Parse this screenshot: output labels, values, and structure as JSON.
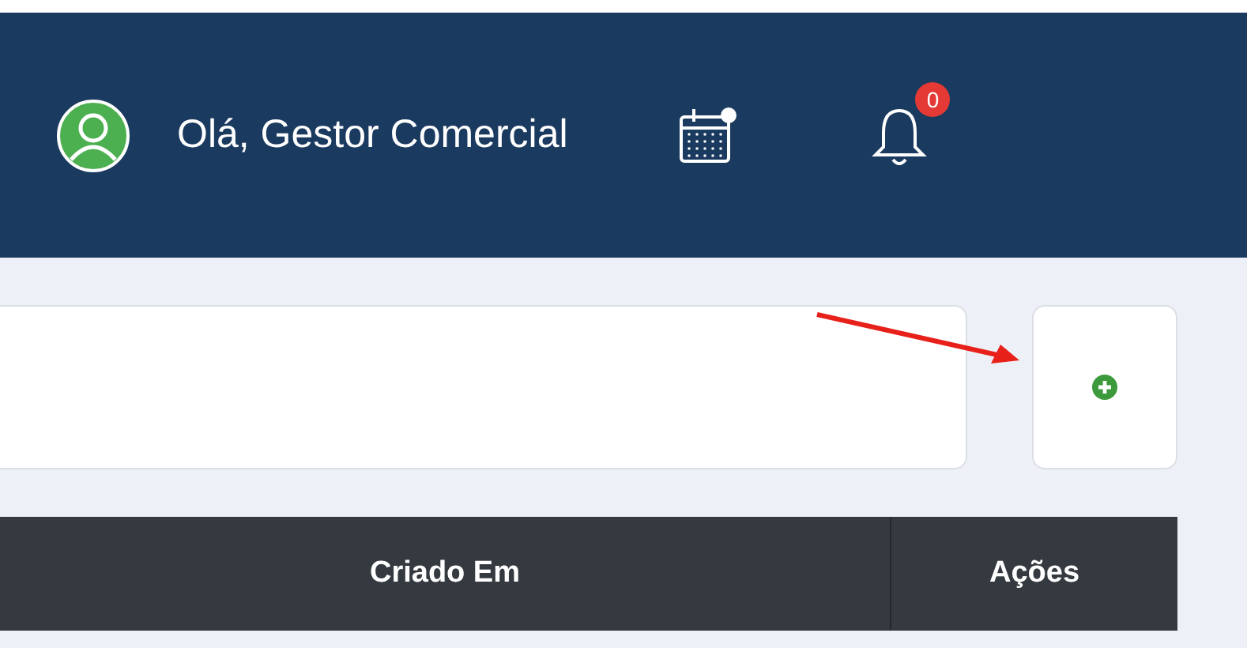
{
  "header": {
    "greeting": "Olá, Gestor Comercial",
    "notification_count": "0"
  },
  "table": {
    "columns": [
      {
        "label": "Criado Em"
      },
      {
        "label": "Ações"
      }
    ]
  }
}
